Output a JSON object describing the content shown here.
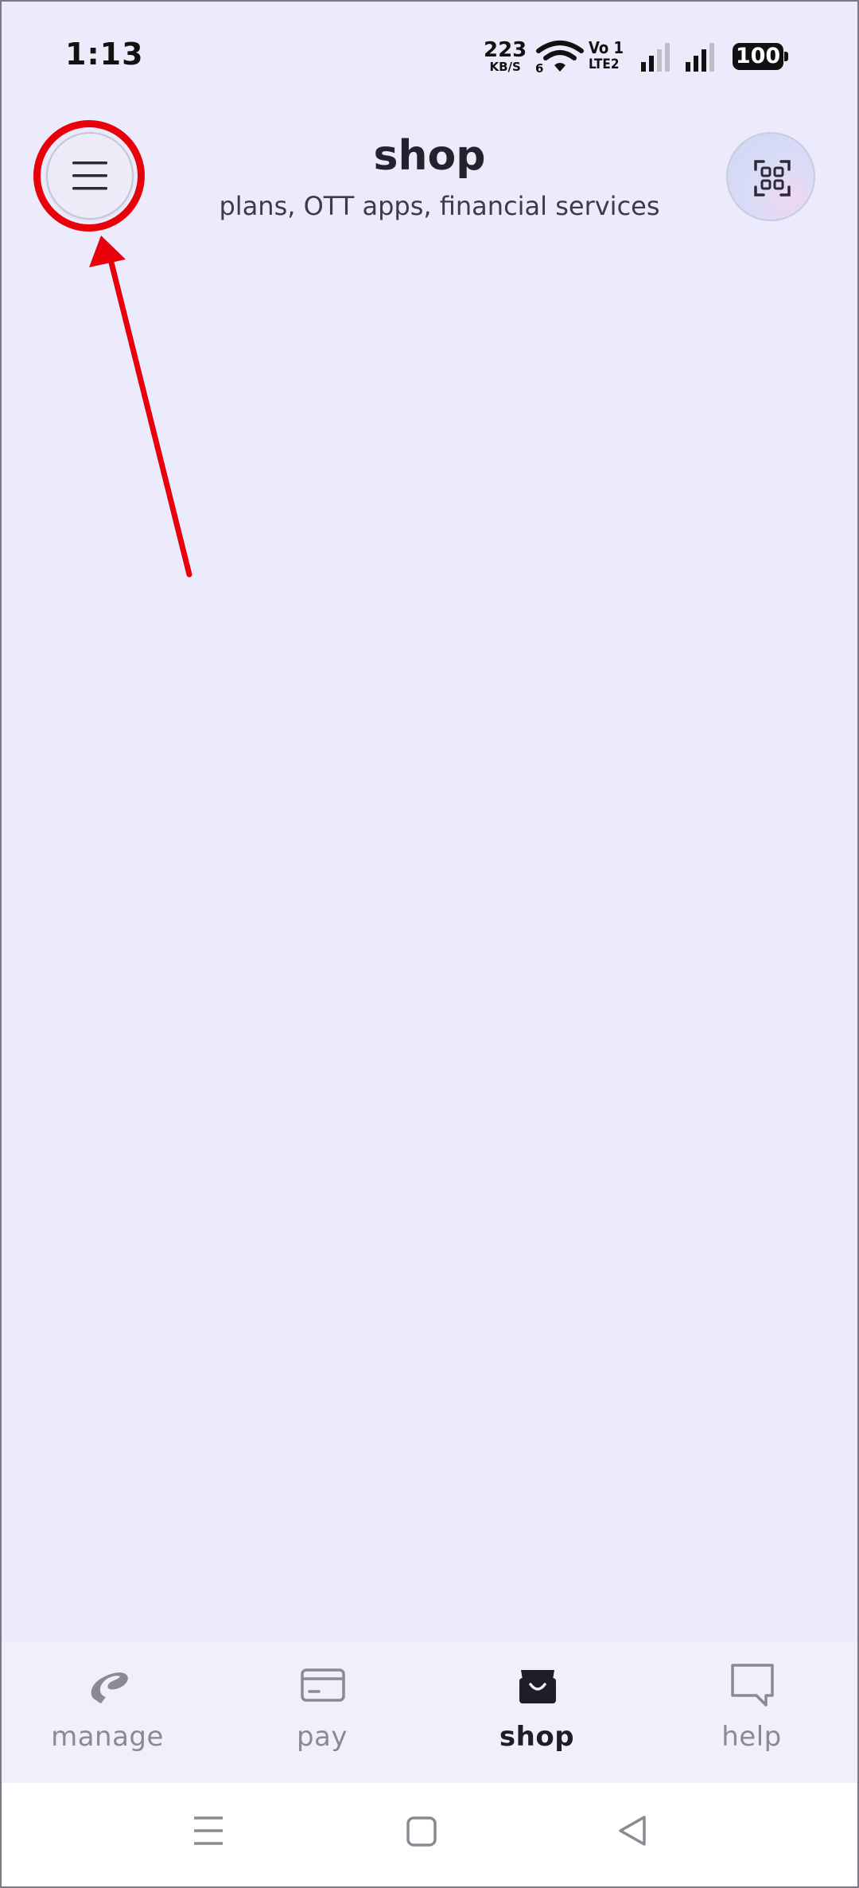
{
  "status_bar": {
    "time": "1:13",
    "net_speed_value": "223",
    "net_speed_unit": "KB/S",
    "wifi_badge": "6",
    "volte_top": "Vo 1",
    "volte_bottom": "LTE2",
    "battery": "100"
  },
  "header": {
    "title": "shop",
    "subtitle": "plans, OTT apps, financial services",
    "menu_icon": "hamburger-menu-icon",
    "qr_icon": "qr-scan-icon"
  },
  "annotation": {
    "color": "#e8000b"
  },
  "bottom_nav": {
    "items": [
      {
        "label": "manage",
        "icon": "airtel-logo-icon",
        "active": false
      },
      {
        "label": "pay",
        "icon": "card-icon",
        "active": false
      },
      {
        "label": "shop",
        "icon": "shopping-bag-icon",
        "active": true
      },
      {
        "label": "help",
        "icon": "chat-bubble-icon",
        "active": false
      }
    ]
  },
  "system_nav": {
    "buttons": [
      "recents-icon",
      "home-icon",
      "back-icon"
    ]
  },
  "colors": {
    "background": "#ebebfb",
    "nav_background": "#f0f0fb",
    "active_text": "#1e1e26",
    "inactive_text": "#8a8a92"
  }
}
